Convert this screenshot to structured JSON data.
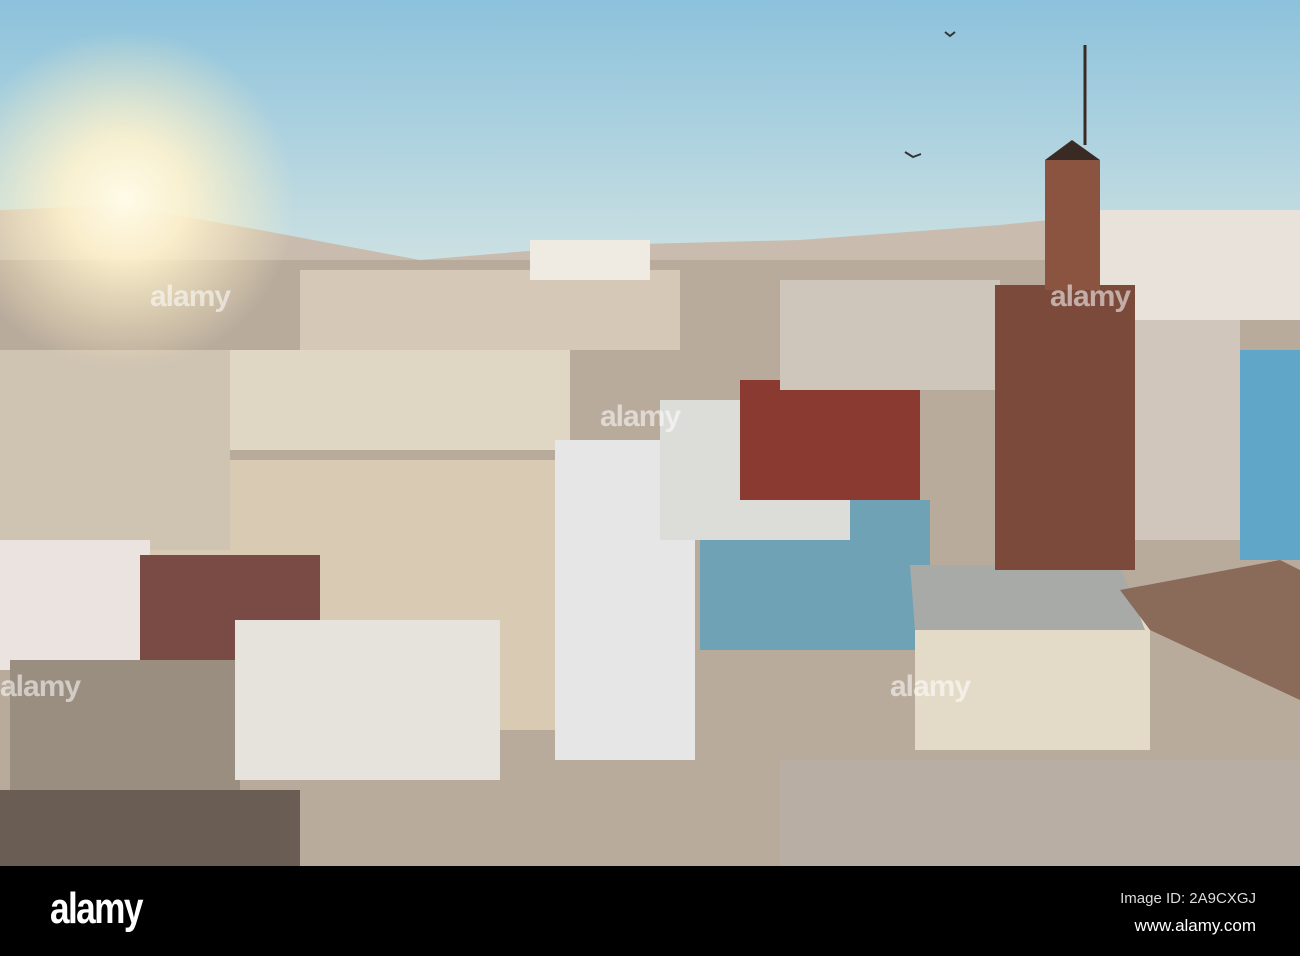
{
  "photo": {
    "subject": "rooftops",
    "colors": {
      "sky_top": "#8fc3dd",
      "sky_bottom": "#d7e6e4",
      "sun": "#fff8e0",
      "wall": "#d8cfc0",
      "blue_wall": "#6fa4b6",
      "minaret": "#7a4a3a"
    }
  },
  "watermark": {
    "text": "alamy"
  },
  "footer": {
    "logo": "alamy",
    "image_id": "Image ID: 2A9CXGJ",
    "url": "www.alamy.com"
  }
}
